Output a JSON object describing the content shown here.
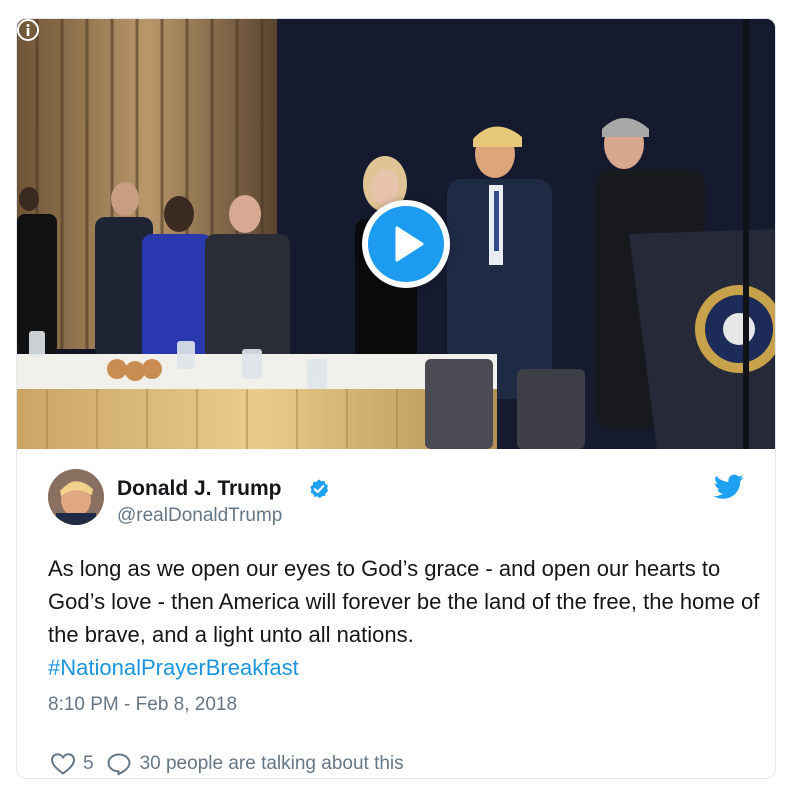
{
  "tweet": {
    "display_name": "Donald J. Trump",
    "handle": "@realDonaldTrump",
    "text_main": "As long as we open our eyes to God’s grace - and open our hearts to God’s love - then America will forever be the land of the free, the home of the brave, and a light unto all nations.",
    "hashtag": "#NationalPrayerBreakfast",
    "timestamp": "8:10 PM - Feb 8, 2018",
    "like_count": "5",
    "talking_text": "30 people are talking about this"
  },
  "icons": {
    "info": "info-icon",
    "play": "play-icon",
    "verified": "verified-badge-icon",
    "brand": "twitter-bird-icon",
    "like": "heart-icon",
    "reply": "speech-bubble-icon"
  },
  "colors": {
    "brand_blue": "#1da1f2",
    "link_blue": "#1b95e0",
    "text_primary": "#14171a",
    "text_secondary": "#657786",
    "border": "#e1e8ed"
  }
}
